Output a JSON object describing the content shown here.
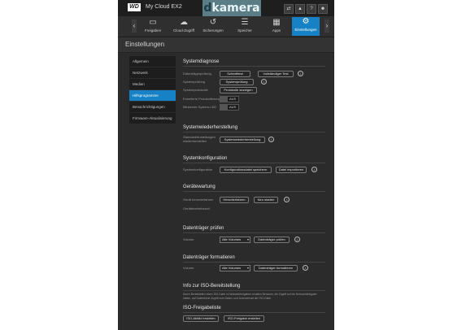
{
  "header": {
    "logo": "WD",
    "product": "My Cloud EX2",
    "brand_prefix": "d",
    "brand_rest": "kamera",
    "icons": [
      "usb-icon",
      "bell-icon",
      "help-icon",
      "user-icon"
    ],
    "icon_glyphs": [
      "⇄",
      "▲",
      "?",
      "☻"
    ]
  },
  "nav": {
    "items": [
      {
        "label": "Freigaben",
        "glyph": "▭"
      },
      {
        "label": "Cloud-Zugriff",
        "glyph": "☁"
      },
      {
        "label": "Sicherungen",
        "glyph": "↺"
      },
      {
        "label": "Speicher",
        "glyph": "☰"
      },
      {
        "label": "Apps",
        "glyph": "▦"
      },
      {
        "label": "Einstellungen",
        "glyph": "⚙"
      }
    ],
    "left_arrow": "‹",
    "right_arrow": "›"
  },
  "page": {
    "title": "Einstellungen"
  },
  "sidebar": {
    "items": [
      "Allgemein",
      "Netzwerk",
      "Medien",
      "Hilfsprogramme",
      "Benachrichtigungen",
      "Firmware-Aktualisierung"
    ],
    "active": "Hilfsprogramme"
  },
  "diag": {
    "title": "Systemdiagnose",
    "test_label": "Datenträgerprüfung",
    "quick_test": "Schnelltest",
    "full_test": "Vollständiger Test",
    "check_label": "Systemprüfung",
    "check_btn": "Systemprüfung",
    "log_label": "Systemprotokolle",
    "log_btn": "Protokolle anzeigen",
    "ext_log_label": "Erweiterte Protokollierung",
    "ext_log_state": "AUS",
    "led_label": "Blinkende System-LED",
    "led_state": "AUS"
  },
  "restore": {
    "title": "Systemwiederherstellung",
    "label": "Standardeinstellungen wiederherstellen",
    "btn": "Systemwiederherstellung"
  },
  "config": {
    "title": "Systemkonfiguration",
    "label": "Systemkonfiguration",
    "save_btn": "Konfigurationsdatei speichern",
    "import_btn": "Datei importieren"
  },
  "maint": {
    "title": "Gerätewartung",
    "label": "Gerät herunterfahren",
    "shutdown_btn": "Herunterfahren",
    "restart_btn": "Neu starten",
    "sleep_label": "Gerätebetriebszeit"
  },
  "scan": {
    "title": "Datenträger prüfen",
    "label": "Volume",
    "select": "Alle Volumes",
    "btn": "Datenträger prüfen"
  },
  "format": {
    "title": "Datenträger formatieren",
    "label": "Volume",
    "select": "Alle Volumes",
    "btn": "Datenträger formatieren"
  },
  "iso": {
    "info_title": "Info zur ISO-Bereitstellung",
    "info_text": "Durch Bereitstellen eines ISO-Datei in Netzwerkfreigaben erhalten Benutzer, die Zugriff auf die Netzwerkfreigabe haben, auf Dateiebene Zugriff zum Daten- und Unterverhalt der ISO-Datei.",
    "shares_title": "ISO-Freigabeliste",
    "create_btn": "ISO-Abbild erstellen",
    "share_btn": "ISO-Freigabe erstellen"
  }
}
